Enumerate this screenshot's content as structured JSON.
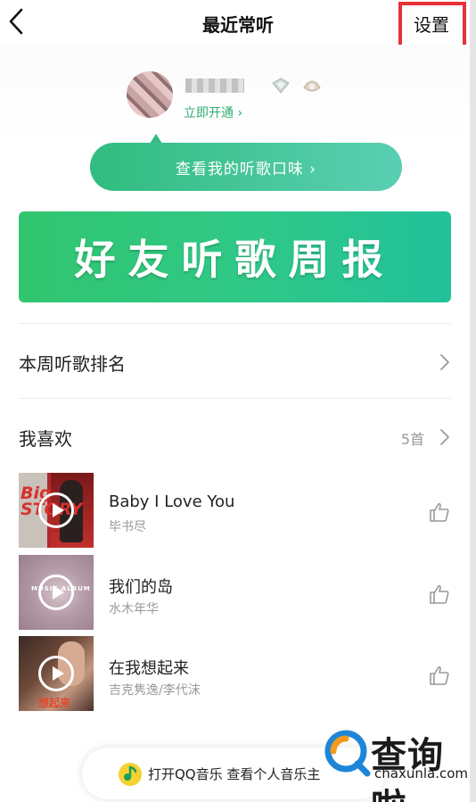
{
  "header": {
    "title": "最近常听",
    "settings_label": "设置"
  },
  "profile": {
    "vip_link": "立即开通 ›"
  },
  "taste_button": "查看我的听歌口味 ›",
  "weekly_banner": "好友听歌周报",
  "rank_row": {
    "label": "本周听歌排名"
  },
  "likes_row": {
    "label": "我喜欢",
    "count": "5首"
  },
  "songs": [
    {
      "title": "Baby I Love You",
      "artist": "毕书尽",
      "cover_text": "Big STORY"
    },
    {
      "title": "我们的岛",
      "artist": "水木年华",
      "cover_text": "MUSIC ALBUM"
    },
    {
      "title": "在我想起来",
      "artist": "吉克隽逸/李代沫",
      "cover_text": "想起来"
    }
  ],
  "open_app_bar": "打开QQ音乐 查看个人音乐主",
  "watermark": {
    "cn": "查询啦",
    "en": "chaxunla.com"
  },
  "colors": {
    "accent_green": "#31bc7f",
    "annotation_red": "#e8303a"
  },
  "icons": [
    "back-icon",
    "vip-badge-icon",
    "level-badge-icon",
    "chevron-right-icon",
    "play-icon",
    "thumbs-up-icon",
    "qq-music-icon"
  ]
}
